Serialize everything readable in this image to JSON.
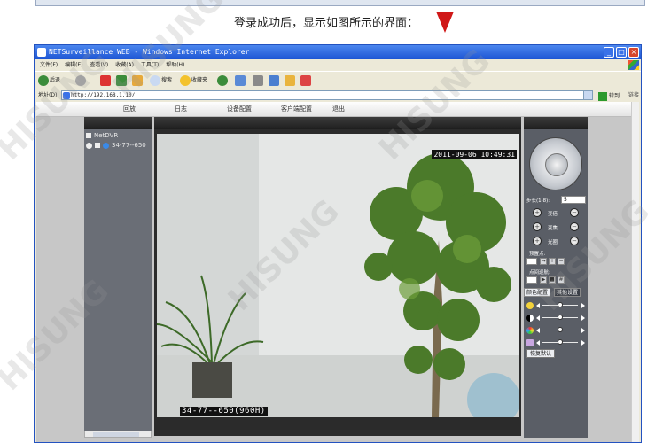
{
  "instruction": {
    "text": "登录成功后，显示如图所示的界面："
  },
  "browser": {
    "title": "NETSurveillance WEB - Windows Internet Explorer",
    "menu": [
      "文件(F)",
      "编辑(E)",
      "查看(V)",
      "收藏(A)",
      "工具(T)",
      "帮助(H)"
    ],
    "toolbar": {
      "back_label": "后退",
      "search_label": "搜索",
      "favorites_label": "收藏夹"
    },
    "address": {
      "label": "地址(D)",
      "url": "http://192.168.1.10/",
      "go_label": "转到",
      "links_label": "链接"
    }
  },
  "app": {
    "nav": [
      "回放",
      "日志",
      "设备配置",
      "客户端配置",
      "退出"
    ],
    "device_tree": {
      "root": "NetDVR",
      "channel": "34-77--650"
    },
    "video": {
      "timestamp": "2011-09-06 10:49:31",
      "channel_name": "34-77--650(960H)"
    },
    "ptz": {
      "step_label": "步长(1-8):",
      "step_value": "5",
      "controls": [
        "变倍",
        "变焦",
        "光圈"
      ],
      "preset_label": "预置点:",
      "cruise_label": "点间巡航:"
    },
    "tabs": [
      "颜色配置",
      "其他设置"
    ],
    "color_sliders": [
      {
        "icon": "brightness-icon",
        "value": 0.5
      },
      {
        "icon": "contrast-icon",
        "value": 0.5
      },
      {
        "icon": "saturation-icon",
        "value": 0.5
      },
      {
        "icon": "hue-icon",
        "value": 0.5
      }
    ],
    "restore_label": "恢复默认"
  },
  "watermark": "HISUNG"
}
